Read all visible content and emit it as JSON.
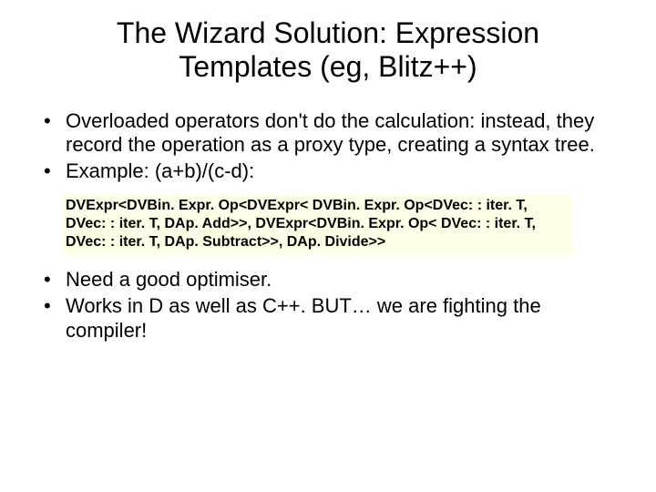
{
  "title": "The Wizard Solution: Expression Templates (eg, Blitz++)",
  "bullets_top": [
    "Overloaded operators don't do the calculation: instead, they record the operation as a proxy type, creating a syntax tree.",
    " Example: (a+b)/(c-d):"
  ],
  "code": "DVExpr<DVBin. Expr. Op<DVExpr< DVBin. Expr. Op<DVec: : iter. T, DVec: : iter. T, DAp. Add>>, DVExpr<DVBin. Expr. Op< DVec: : iter. T, DVec: : iter. T, DAp. Subtract>>, DAp. Divide>>",
  "bullets_bottom": [
    "Need a good optimiser.",
    "Works in D as well as C++. BUT… we are fighting the compiler!"
  ]
}
